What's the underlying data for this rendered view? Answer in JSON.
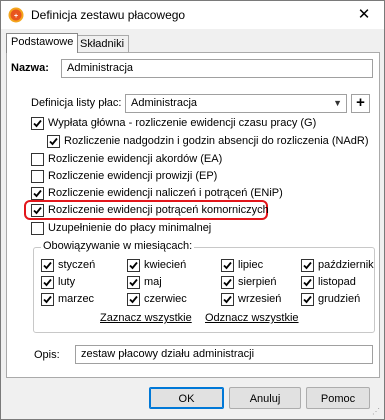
{
  "window": {
    "title": "Definicja zestawu płacowego",
    "icon": "app-icon"
  },
  "tabs": [
    {
      "label": "Podstawowe",
      "active": true
    },
    {
      "label": "Składniki",
      "active": false
    }
  ],
  "name_field": {
    "label": "Nazwa:",
    "value": "Administracja"
  },
  "payroll_list": {
    "label": "Definicja listy płac:",
    "value": "Administracja",
    "add_label": "+"
  },
  "checkboxes": [
    {
      "label": "Wypłata główna - rozliczenie ewidencji czasu pracy (G)",
      "checked": true
    },
    {
      "label": "Rozliczenie nadgodzin i godzin absencji do rozliczenia (NAdR)",
      "checked": true
    },
    {
      "label": "Rozliczenie ewidencji akordów (EA)",
      "checked": false
    },
    {
      "label": "Rozliczenie ewidencji prowizji (EP)",
      "checked": false
    },
    {
      "label": "Rozliczenie ewidencji naliczeń i potrąceń (ENiP)",
      "checked": true
    },
    {
      "label": "Rozliczenie ewidencji potrąceń komorniczych",
      "checked": true
    },
    {
      "label": "Uzupełnienie do płacy minimalnej",
      "checked": false
    }
  ],
  "months_group": {
    "title": "Obowiązywanie w miesiącach:",
    "months": [
      {
        "label": "styczeń",
        "checked": true
      },
      {
        "label": "kwiecień",
        "checked": true
      },
      {
        "label": "lipiec",
        "checked": true
      },
      {
        "label": "październik",
        "checked": true
      },
      {
        "label": "luty",
        "checked": true
      },
      {
        "label": "maj",
        "checked": true
      },
      {
        "label": "sierpień",
        "checked": true
      },
      {
        "label": "listopad",
        "checked": true
      },
      {
        "label": "marzec",
        "checked": true
      },
      {
        "label": "czerwiec",
        "checked": true
      },
      {
        "label": "wrzesień",
        "checked": true
      },
      {
        "label": "grudzień",
        "checked": true
      }
    ],
    "select_all": "Zaznacz wszystkie",
    "deselect_all": "Odznacz wszystkie"
  },
  "description": {
    "label": "Opis:",
    "value": "zestaw płacowy działu administracji"
  },
  "buttons": {
    "ok": "OK",
    "cancel": "Anuluj",
    "help": "Pomoc"
  },
  "colors": {
    "highlight": "#e2161b",
    "default_button_border": "#0078d7"
  }
}
